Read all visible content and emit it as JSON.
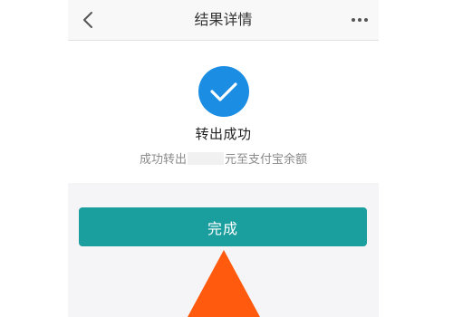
{
  "header": {
    "title": "结果详情",
    "back_icon": "chevron-left-icon",
    "more_icon": "ellipsis-icon"
  },
  "result": {
    "icon": "check-circle-icon",
    "title": "转出成功",
    "desc_prefix": "成功转出",
    "desc_suffix": "元至支付宝余额"
  },
  "actions": {
    "done_label": "完成"
  },
  "colors": {
    "accent": "#1a9e9e",
    "success_icon": "#1b8de3",
    "arrow": "#ff5a0e"
  }
}
